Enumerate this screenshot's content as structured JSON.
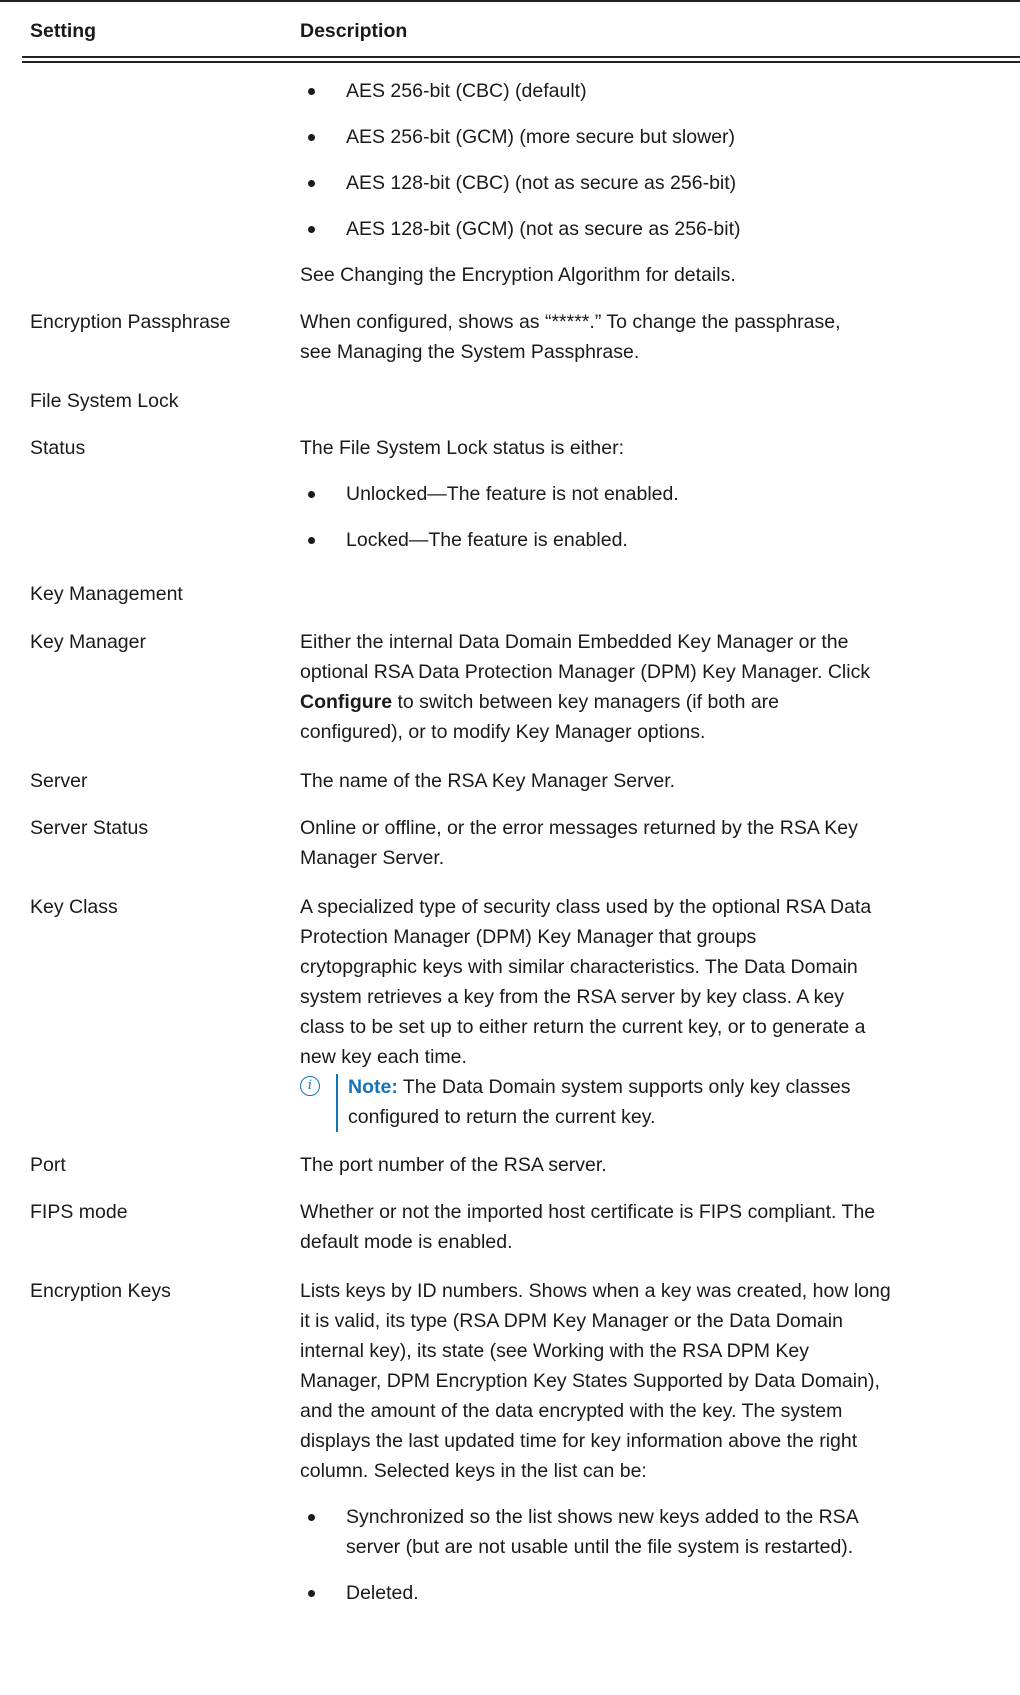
{
  "header": {
    "col1": "Setting",
    "col2": "Description"
  },
  "row0": {
    "bullets": [
      "AES 256-bit (CBC) (default)",
      "AES 256-bit (GCM) (more secure but slower)",
      "AES 128-bit (CBC) (not as secure as 256-bit)",
      "AES 128-bit (GCM) (not as secure as 256-bit)"
    ],
    "text": "See Changing the Encryption Algorithm for details."
  },
  "passphrase": {
    "setting": "Encryption Passphrase",
    "line1": "When configured, shows as “*****.” To change the passphrase,",
    "line2": "see Managing the System Passphrase."
  },
  "fslock": {
    "setting": "File System Lock"
  },
  "status": {
    "setting": "Status",
    "text": "The File System Lock status is either:",
    "bullets": [
      "Unlocked—The feature is not enabled.",
      "Locked—The feature is enabled."
    ]
  },
  "keymgmt": {
    "setting": "Key Management"
  },
  "keymanager": {
    "setting": "Key Manager",
    "line1": "Either the internal Data Domain Embedded Key Manager or the",
    "line2": "optional RSA Data Protection Manager (DPM) Key Manager. Click",
    "bold": "Configure",
    "line3_rest": " to switch between key managers (if both are",
    "line4": "configured), or to modify Key Manager options."
  },
  "server": {
    "setting": "Server",
    "text": "The name of the RSA Key Manager Server."
  },
  "serverstatus": {
    "setting": "Server Status",
    "line1": "Online or offline, or the error messages returned by the RSA Key",
    "line2": "Manager Server."
  },
  "keyclass": {
    "setting": "Key Class",
    "lines": [
      "A specialized type of security class used by the optional RSA Data",
      "Protection Manager (DPM) Key Manager that groups",
      "crytopgraphic keys with similar characteristics. The Data Domain",
      "system retrieves a key from the RSA server by key class. A key",
      "class to be set up to either return the current key, or to generate a",
      "new key each time."
    ],
    "note_label": "Note:",
    "note_line1": " The Data Domain system supports only key classes",
    "note_line2": "configured to return the current key."
  },
  "port": {
    "setting": "Port",
    "text": "The port number of the RSA server."
  },
  "fips": {
    "setting": "FIPS mode",
    "line1": "Whether or not the imported host certificate is FIPS compliant. The",
    "line2": "default mode is enabled."
  },
  "enckeys": {
    "setting": "Encryption Keys",
    "lines": [
      "Lists keys by ID numbers. Shows when a key was created, how long",
      "it is valid, its type (RSA DPM Key Manager or the Data Domain",
      "internal key), its state (see Working with the RSA DPM Key",
      "Manager, DPM Encryption Key States Supported by Data Domain),",
      "and the amount of the data encrypted with the key. The system",
      "displays the last updated time for key information above the right",
      "column. Selected keys in the list can be:"
    ],
    "bullet1_line1": "Synchronized so the list shows new keys added to the RSA",
    "bullet1_line2": "server (but are not usable until the file system is restarted).",
    "bullet2": "Deleted."
  }
}
